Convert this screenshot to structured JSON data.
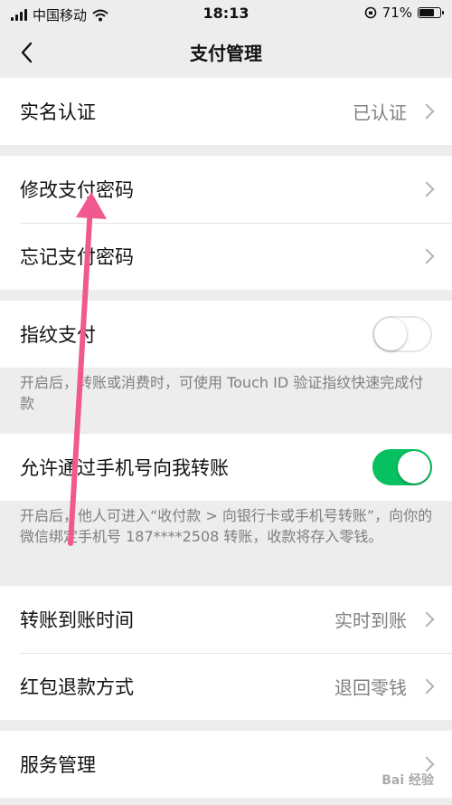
{
  "status_bar": {
    "carrier": "中国移动",
    "time": "18:13",
    "battery": "71%",
    "battery_level": 0.71
  },
  "nav": {
    "title": "支付管理"
  },
  "rows": {
    "real_name": {
      "label": "实名认证",
      "value": "已认证"
    },
    "change_password": {
      "label": "修改支付密码"
    },
    "forgot_password": {
      "label": "忘记支付密码"
    },
    "fingerprint": {
      "label": "指纹支付",
      "enabled": false
    },
    "phone_transfer": {
      "label": "允许通过手机号向我转账",
      "enabled": true
    },
    "transfer_time": {
      "label": "转账到账时间",
      "value": "实时到账"
    },
    "red_packet_refund": {
      "label": "红包退款方式",
      "value": "退回零钱"
    },
    "service_management": {
      "label": "服务管理"
    }
  },
  "notes": {
    "fingerprint": "开启后，转账或消费时，可使用 Touch ID 验证指纹快速完成付款",
    "phone_transfer": "开启后，他人可进入“收付款 > 向银行卡或手机号转账”，向你的微信绑定手机号 187****2508 转账，收款将存入零钱。"
  },
  "colors": {
    "accent_green": "#07c160",
    "annotation_arrow": "#f0588f",
    "background": "#ededed"
  },
  "watermark": "Bai 经验"
}
